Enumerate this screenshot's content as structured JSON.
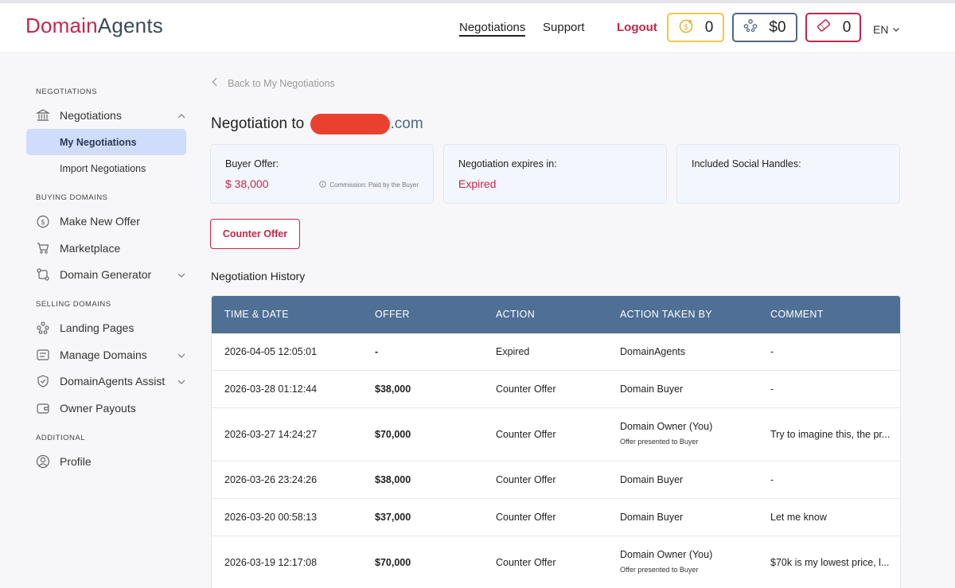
{
  "header": {
    "logo_part1": "Domain",
    "logo_part2": "Agents",
    "nav_negotiations": "Negotiations",
    "nav_support": "Support",
    "logout": "Logout",
    "coins_count": "0",
    "balance": "$0",
    "tickets_count": "0",
    "language": "EN"
  },
  "sidebar": {
    "section_negotiations": "NEGOTIATIONS",
    "negotiations": "Negotiations",
    "my_negotiations": "My Negotiations",
    "import_negotiations": "Import Negotiations",
    "section_buying": "BUYING DOMAINS",
    "make_new_offer": "Make New Offer",
    "marketplace": "Marketplace",
    "domain_generator": "Domain Generator",
    "section_selling": "SELLING DOMAINS",
    "landing_pages": "Landing Pages",
    "manage_domains": "Manage Domains",
    "assist": "DomainAgents Assist",
    "owner_payouts": "Owner Payouts",
    "section_additional": "ADDITIONAL",
    "profile": "Profile"
  },
  "main": {
    "back_link": "Back to My Negotiations",
    "title_prefix": "Negotiation to",
    "title_suffix": ".com",
    "buyer_offer_label": "Buyer Offer:",
    "buyer_offer_value": "$ 38,000",
    "commission_note": "Commission: Paid by the Buyer",
    "expires_label": "Negotiation expires in:",
    "expires_value": "Expired",
    "social_label": "Included Social Handles:",
    "counter_offer_button": "Counter Offer",
    "history_title": "Negotiation History"
  },
  "table": {
    "headers": [
      "TIME & DATE",
      "OFFER",
      "ACTION",
      "ACTION TAKEN BY",
      "COMMENT"
    ],
    "rows": [
      {
        "time": "2026-04-05 12:05:01",
        "offer": "-",
        "action": "Expired",
        "by": "DomainAgents",
        "by_note": "",
        "comment": "-"
      },
      {
        "time": "2026-03-28 01:12:44",
        "offer": "$38,000",
        "action": "Counter Offer",
        "by": "Domain Buyer",
        "by_note": "",
        "comment": "-"
      },
      {
        "time": "2026-03-27 14:24:27",
        "offer": "$70,000",
        "action": "Counter Offer",
        "by": "Domain Owner (You)",
        "by_note": "Offer presented to Buyer",
        "comment": "Try to imagine this, the pr..."
      },
      {
        "time": "2026-03-26 23:24:26",
        "offer": "$38,000",
        "action": "Counter Offer",
        "by": "Domain Buyer",
        "by_note": "",
        "comment": "-"
      },
      {
        "time": "2026-03-20 00:58:13",
        "offer": "$37,000",
        "action": "Counter Offer",
        "by": "Domain Buyer",
        "by_note": "",
        "comment": "Let me know"
      },
      {
        "time": "2026-03-19 12:17:08",
        "offer": "$70,000",
        "action": "Counter Offer",
        "by": "Domain Owner (You)",
        "by_note": "Offer presented to Buyer",
        "comment": "$70k is my lowest price, l..."
      }
    ]
  },
  "colors": {
    "brand": "#c2284a",
    "table_header": "#4f6f94",
    "active_item": "#cfdcfb"
  }
}
